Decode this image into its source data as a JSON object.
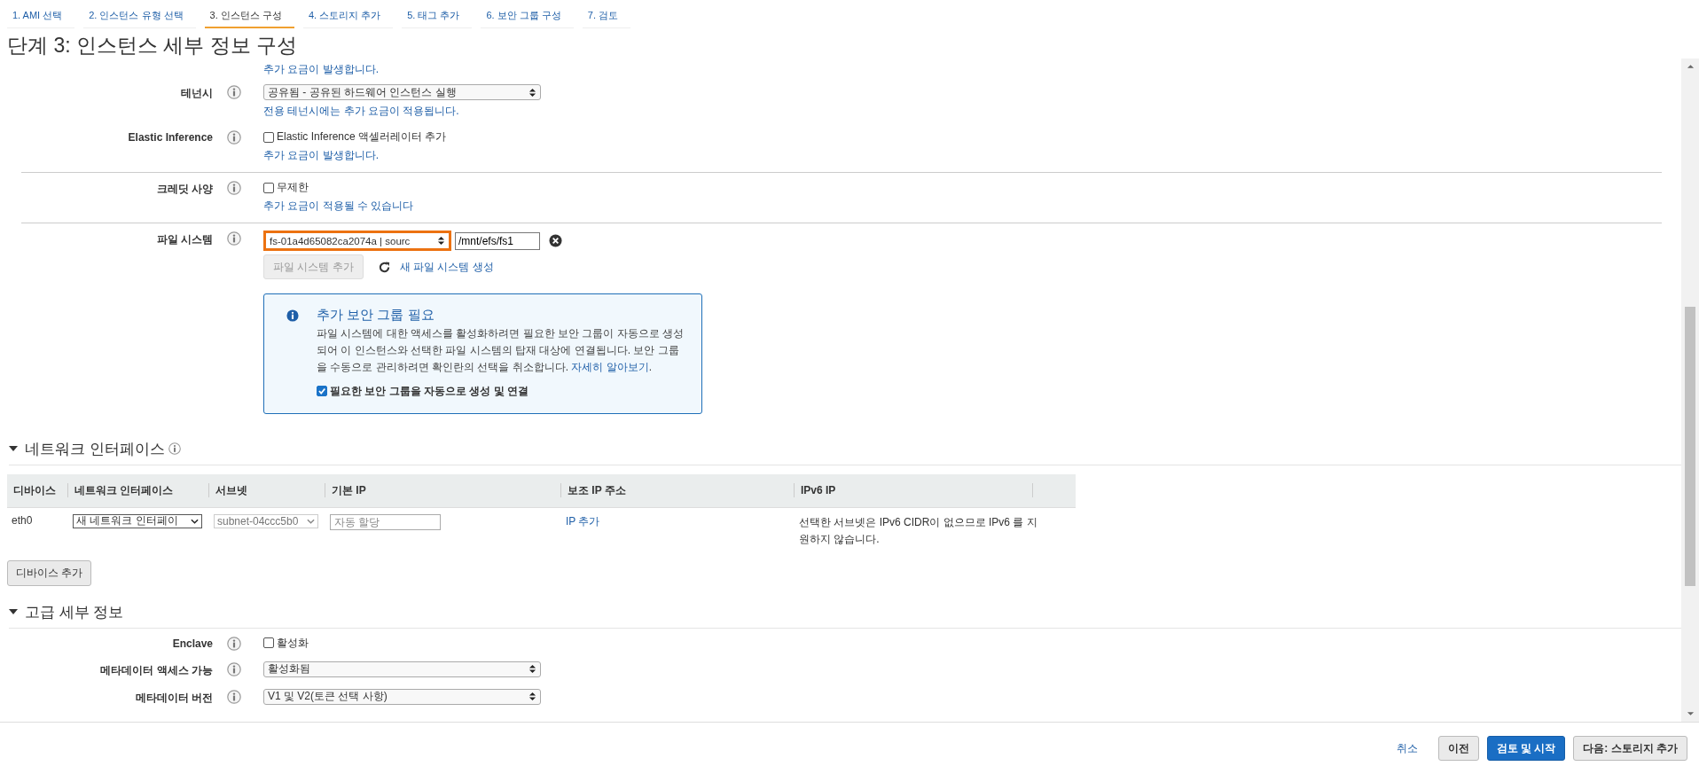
{
  "steps": [
    {
      "label": "1. AMI 선택",
      "selected": false
    },
    {
      "label": "2. 인스턴스 유형 선택",
      "selected": false
    },
    {
      "label": "3. 인스턴스 구성",
      "selected": true
    },
    {
      "label": "4. 스토리지 추가",
      "selected": false
    },
    {
      "label": "5. 태그 추가",
      "selected": false
    },
    {
      "label": "6. 보안 그룹 구성",
      "selected": false
    },
    {
      "label": "7. 검토",
      "selected": false
    }
  ],
  "title": "단계 3: 인스턴스 세부 정보 구성",
  "top_note": "추가 요금이 발생합니다.",
  "groups": [
    [
      {
        "kind": "select",
        "label": "테넌시",
        "value": "공유됨 - 공유된 하드웨어 인스턴스 실행",
        "help": "전용 테넌시에는 추가 요금이 적용됩니다."
      },
      {
        "kind": "checkbox",
        "label": "Elastic Inference",
        "option": "Elastic Inference 액셀러레이터 추가",
        "checked": false,
        "help": "추가 요금이 발생합니다."
      }
    ],
    [
      {
        "kind": "checkbox",
        "label": "크레딧 사양",
        "option": "무제한",
        "checked": false,
        "help": "추가 요금이 적용될 수 있습니다"
      }
    ],
    [
      {
        "kind": "filesystem",
        "label": "파일 시스템",
        "value": "fs-01a4d65082ca2074a | sourc",
        "path": "/mnt/efs/fs1",
        "add_button": {
          "label": "파일 시스템 추가",
          "disabled": true
        },
        "link": "새 파일 시스템 생성",
        "notice": {
          "title": "추가 보안 그룹 필요",
          "text": "파일 시스템에 대한 액세스를 활성화하려면 필요한 보안 그룹이 자동으로 생성되어 이 인스턴스와 선택한 파일 시스템의 탑재 대상에 연결됩니다. 보안 그룹을 수동으로 관리하려면 확인란의 선택을 취소합니다.",
          "link": "자세히 알아보기",
          "after": ".",
          "option": "필요한 보안 그룹을 자동으로 생성 및 연결",
          "checked": true
        }
      }
    ]
  ],
  "network": {
    "title": "네트워크 인터페이스",
    "expanded": true,
    "columns": [
      "디바이스",
      "네트워크 인터페이스",
      "서브넷",
      "기본 IP",
      "보조 IP 주소",
      "IPv6 IP"
    ],
    "rows": [
      {
        "device": "eth0",
        "interface": "새 네트워크 인터페이",
        "subnet": "subnet-04ccc5b0",
        "ip_placeholder": "자동 할당",
        "secondary": "IP 추가",
        "ipv6": "선택한 서브넷은 IPv6 CIDR이 없으므로 IPv6 를 지원하지 않습니다."
      }
    ],
    "add_button": "디바이스 추가"
  },
  "advanced": {
    "title": "고급 세부 정보",
    "expanded": true,
    "rows": [
      {
        "kind": "checkbox",
        "label": "Enclave",
        "option": "활성화",
        "checked": false
      },
      {
        "kind": "select",
        "label": "메타데이터 액세스 가능",
        "value": "활성화됨"
      },
      {
        "kind": "select",
        "label": "메타데이터 버전",
        "value": "V1 및 V2(토큰 선택 사항)"
      }
    ]
  },
  "footer": {
    "cancel": "취소",
    "buttons": [
      {
        "label": "이전",
        "kind": "secondary"
      },
      {
        "label": "검토 및 시작",
        "kind": "primary"
      },
      {
        "label": "다음: 스토리지 추가",
        "kind": "secondary"
      }
    ]
  }
}
